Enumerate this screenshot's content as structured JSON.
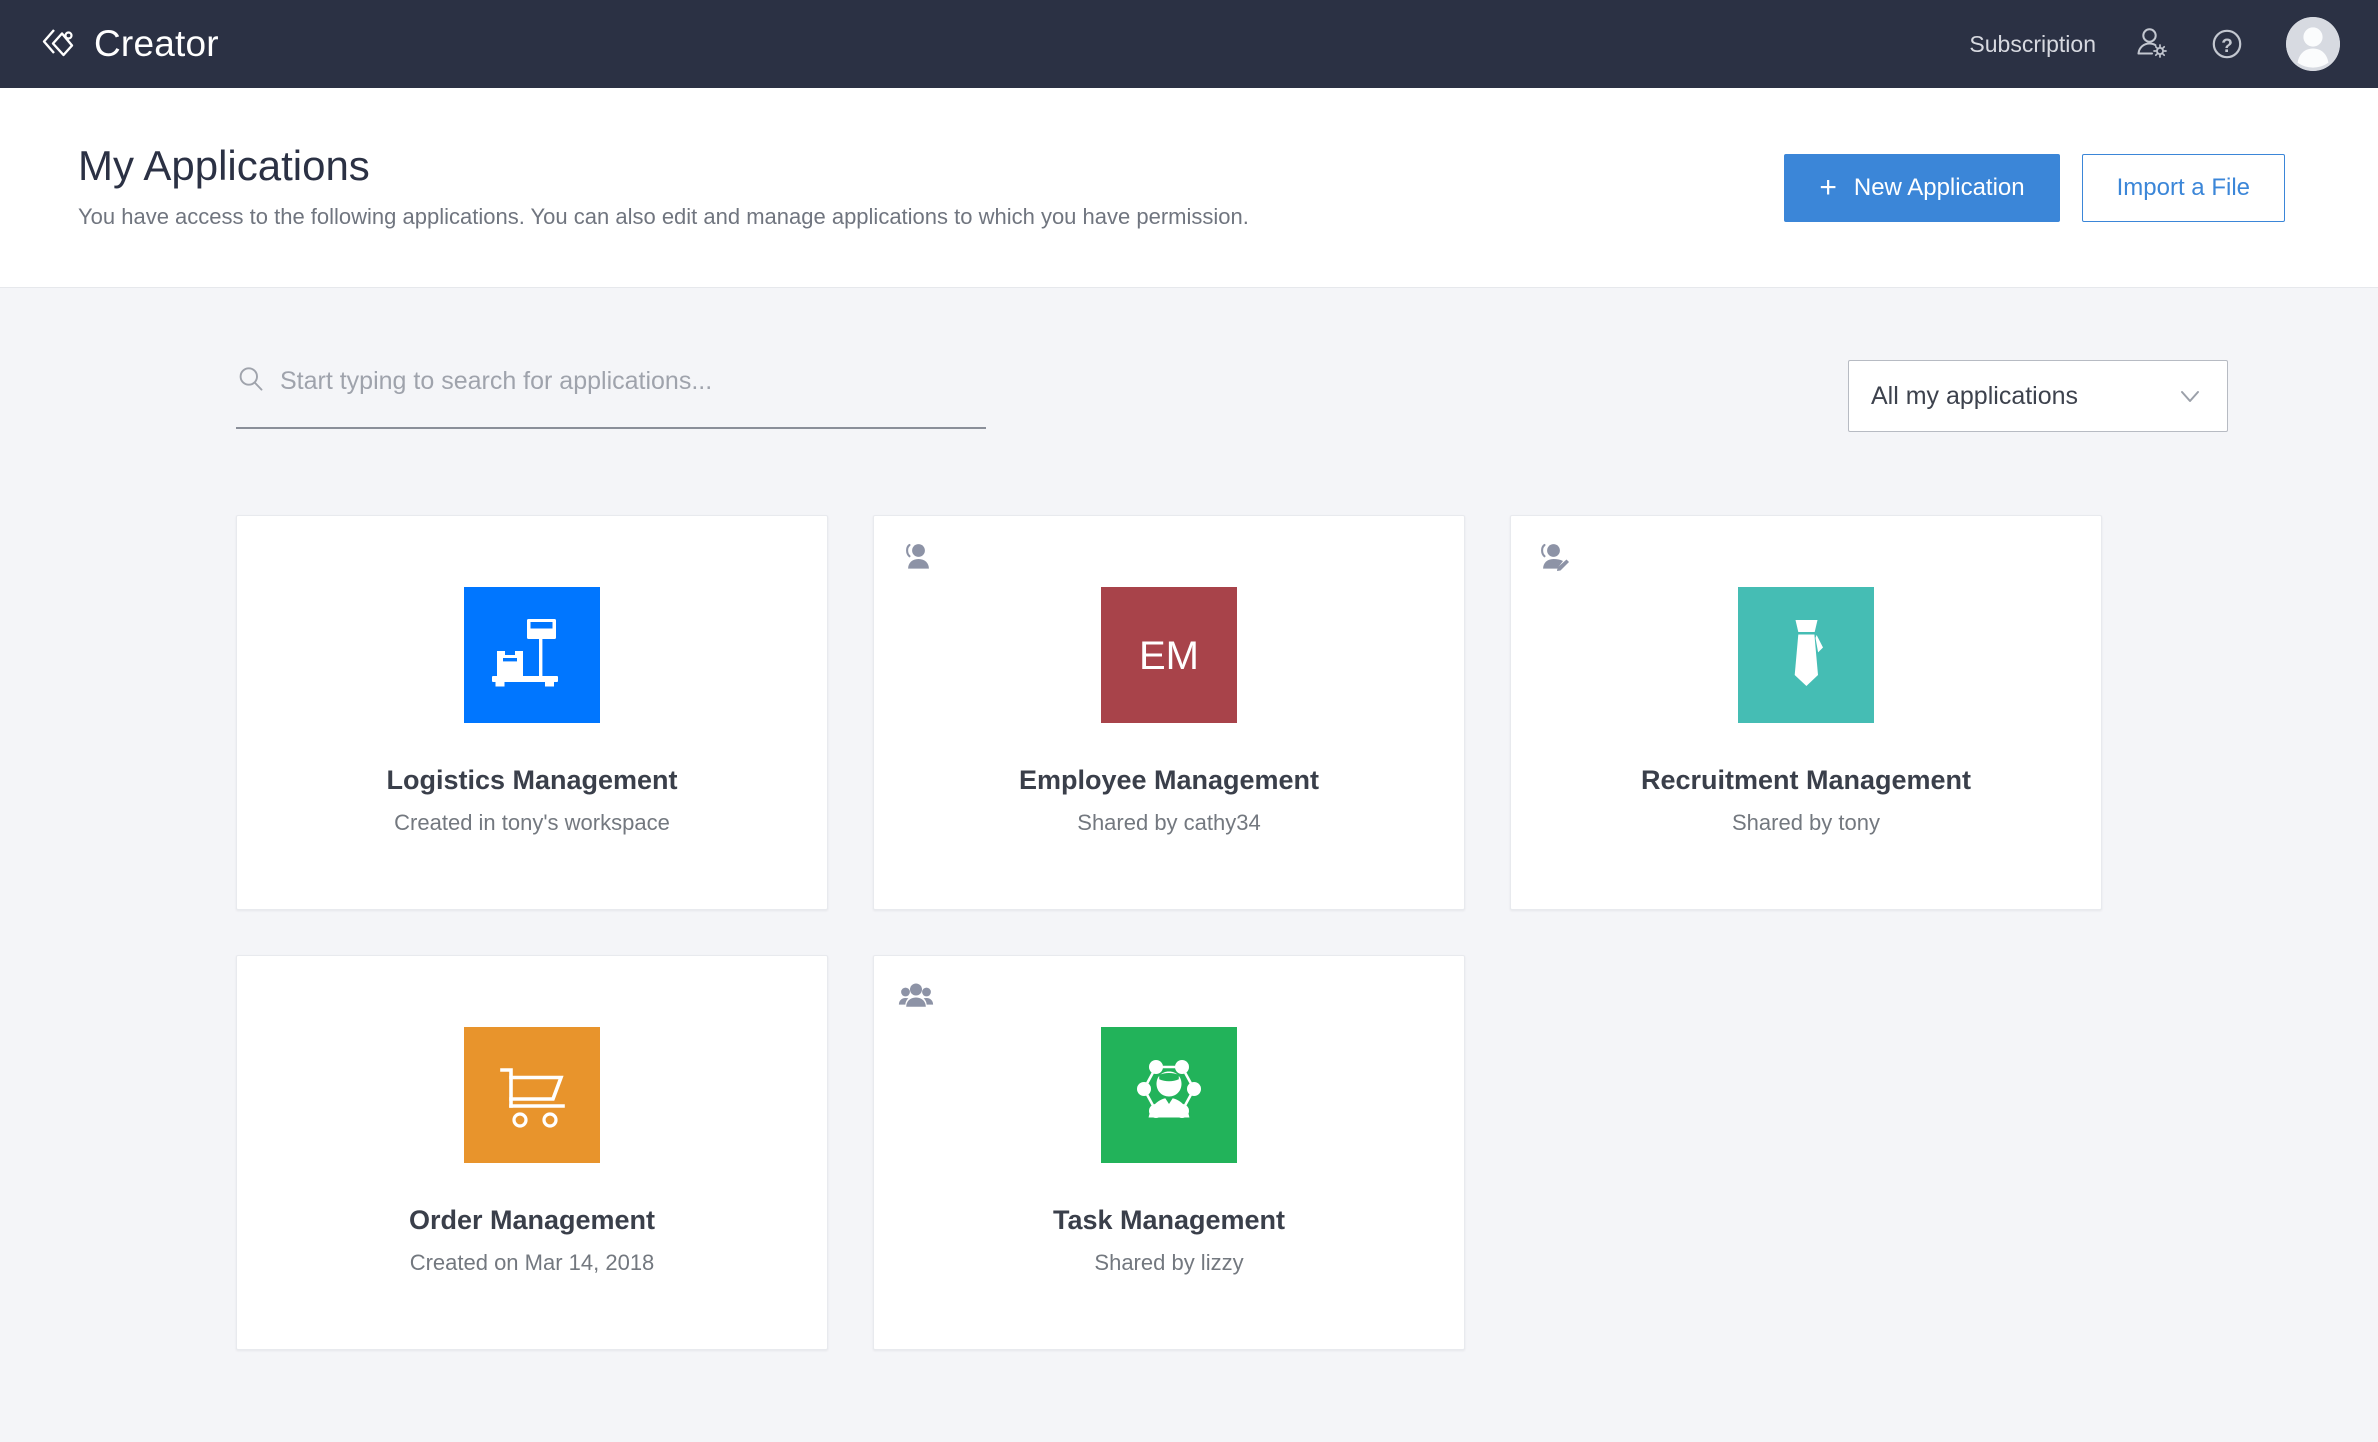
{
  "brand": {
    "name": "Creator",
    "logo_icon": "creator-diamond-logo"
  },
  "topnav": {
    "subscription_label": "Subscription",
    "user_settings_icon": "user-settings-icon",
    "help_icon": "help-question-icon",
    "avatar_icon": "user-avatar",
    "background_color": "#2b3144"
  },
  "header": {
    "title": "My Applications",
    "subtitle": "You have access to the following applications. You can also edit and manage applications to which you have permission.",
    "new_application_label": "New Application",
    "new_application_plus": "+",
    "import_file_label": "Import a File",
    "primary_color": "#3b86d8"
  },
  "filters": {
    "search_placeholder": "Start typing to search for applications...",
    "search_value": "",
    "search_icon": "search-icon",
    "select_value": "All my applications",
    "select_caret_icon": "chevron-down-icon"
  },
  "applications": [
    {
      "name": "Logistics Management",
      "meta": "Created in tony's workspace",
      "icon": "weighing-scale-icon",
      "icon_color": "#0076ff",
      "badge": "none",
      "initials": ""
    },
    {
      "name": "Employee Management",
      "meta": "Shared by cathy34",
      "icon": "initials",
      "icon_color": "#a8434a",
      "badge": "single-user-icon",
      "initials": "EM"
    },
    {
      "name": "Recruitment Management",
      "meta": "Shared by tony",
      "icon": "necktie-icon",
      "icon_color": "#45bdb4",
      "badge": "user-edit-icon",
      "initials": ""
    },
    {
      "name": "Order Management",
      "meta": "Created on Mar 14, 2018",
      "icon": "shopping-cart-icon",
      "icon_color": "#e8942c",
      "badge": "none",
      "initials": ""
    },
    {
      "name": "Task Management",
      "meta": "Shared by lizzy",
      "icon": "network-person-icon",
      "icon_color": "#22b35a",
      "badge": "group-users-icon",
      "initials": ""
    }
  ]
}
